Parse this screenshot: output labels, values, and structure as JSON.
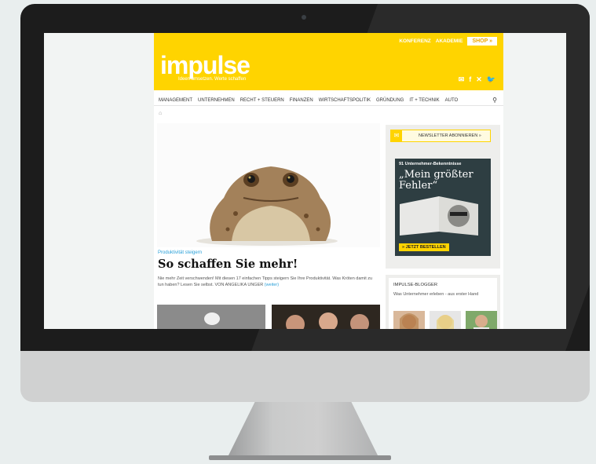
{
  "topnav": {
    "konferenz": "KONFERENZ",
    "akademie": "AKADEMIE",
    "shop": "SHOP »"
  },
  "brand": {
    "logo": "impulse",
    "tagline": "Ideen umsetzen. Werte schaffen"
  },
  "social_icons": [
    "newsletter-icon",
    "facebook-icon",
    "xing-icon",
    "twitter-icon"
  ],
  "nav": [
    "MANAGEMENT",
    "UNTERNEHMEN",
    "RECHT + STEUERN",
    "FINANZEN",
    "WIRTSCHAFTSPOLITIK",
    "GRÜNDUNG",
    "IT + TECHNIK",
    "AUTO"
  ],
  "article": {
    "kicker": "Produktivität steigern",
    "headline": "So schaffen Sie mehr!",
    "teaser": "Nie mehr Zeit verschwenden! Mit diesen 17 einfachen Tipps steigern Sie Ihre Produktivität. Was Kröten damit zu tun haben? Lesen Sie selbst.",
    "byline": "VON ANGELIKA UNGER",
    "more": "(weiter)"
  },
  "sidebar": {
    "newsletter": "NEWSLETTER ABONNIEREN »",
    "ad_sub": "91 Unternehmer-Bekenntnisse",
    "ad_title": "„Mein größter Fehler“",
    "ad_button": "» JETZT BESTELLEN",
    "blogger_title": "IMPULSE-BLOGGER",
    "blogger_sub": "Was Unternehmer erleben - aus erster Hand"
  },
  "colors": {
    "brand_yellow": "#ffd400",
    "link_blue": "#2aa0d8",
    "frame": "#1c1c1c"
  }
}
